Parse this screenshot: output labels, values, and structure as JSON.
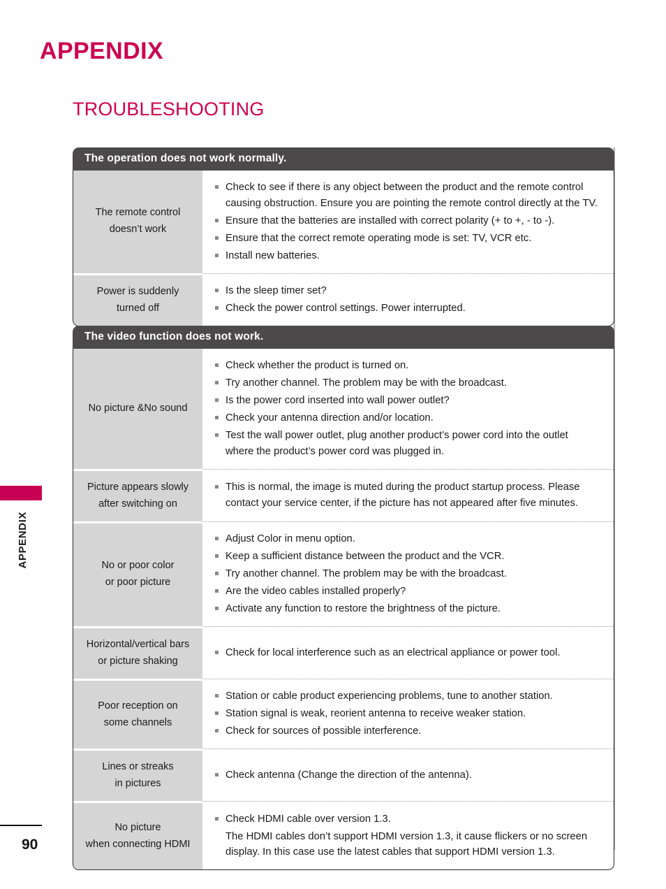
{
  "page": {
    "title": "APPENDIX",
    "section_title": "TROUBLESHOOTING",
    "side_label": "APPENDIX",
    "page_number": "90",
    "accent_color": "#cc0050",
    "header_bar_color": "#4b4949",
    "symptom_cell_color": "#d5d5d5"
  },
  "tables": [
    {
      "header": "The operation does not work normally.",
      "rows": [
        {
          "symptom": "The remote control\ndoesn’t work",
          "symptom_lines": [
            "The remote control",
            "doesn’t work"
          ],
          "fixes": [
            {
              "text": "Check to see if there is any object between the product and the remote control causing obstruction. Ensure you are pointing the remote control directly at the TV.",
              "lines": [
                "Check to see if there is any object between the product and the remote control",
                "causing obstruction. Ensure you are pointing the remote control directly at the TV."
              ]
            },
            {
              "text": "Ensure that the batteries are installed with correct polarity (+ to +, - to -).",
              "lines": [
                "Ensure that the batteries are installed with correct polarity (+ to +, - to -)."
              ]
            },
            {
              "text": "Ensure that the correct remote operating mode is set: TV, VCR etc.",
              "lines": [
                "Ensure that the correct remote operating mode is set: TV, VCR etc."
              ]
            },
            {
              "text": "Install new batteries.",
              "lines": [
                "Install new batteries."
              ]
            }
          ]
        },
        {
          "symptom": "Power is suddenly\nturned off",
          "symptom_lines": [
            "Power is suddenly",
            "turned off"
          ],
          "fixes": [
            {
              "text": "Is the sleep timer set?",
              "lines": [
                "Is the sleep timer set?"
              ]
            },
            {
              "text": "Check the power control settings. Power interrupted.",
              "lines": [
                "Check the power control settings. Power interrupted."
              ]
            }
          ]
        }
      ]
    },
    {
      "header": "The video function does not work.",
      "rows": [
        {
          "symptom": "No picture &No sound",
          "symptom_lines": [
            "No picture &No sound"
          ],
          "fixes": [
            {
              "text": "Check whether the product is turned on.",
              "lines": [
                "Check whether the product is turned on."
              ]
            },
            {
              "text": "Try another channel. The problem may be with the broadcast.",
              "lines": [
                "Try another channel. The problem may be with the broadcast."
              ]
            },
            {
              "text": "Is the power cord inserted into wall power outlet?",
              "lines": [
                "Is the power cord inserted into wall power outlet?"
              ]
            },
            {
              "text": "Check your antenna direction and/or location.",
              "lines": [
                "Check your antenna direction and/or location."
              ]
            },
            {
              "text": "Test the wall power outlet, plug another product’s power cord into the outlet where the product’s power cord was plugged in.",
              "lines": [
                "Test the wall power outlet, plug another product’s power cord into the outlet",
                "where the product’s power cord was plugged in."
              ]
            }
          ]
        },
        {
          "symptom": "Picture appears slowly\nafter switching on",
          "symptom_lines": [
            "Picture appears slowly",
            "after switching on"
          ],
          "fixes": [
            {
              "text": "This is normal, the image is muted during the product startup process. Please contact your service center, if the picture has not appeared after five minutes.",
              "lines": [
                "This is normal, the image is muted during the product startup process. Please",
                "contact your service center, if the picture has not appeared after five minutes."
              ]
            }
          ]
        },
        {
          "symptom": "No or poor color\nor poor picture",
          "symptom_lines": [
            "No or poor color",
            "or poor picture"
          ],
          "fixes": [
            {
              "text": "Adjust Color in menu option.",
              "lines": [
                "Adjust Color in menu option."
              ]
            },
            {
              "text": "Keep a sufficient distance between the product and the VCR.",
              "lines": [
                "Keep a sufficient distance between the product and the VCR."
              ]
            },
            {
              "text": "Try another channel. The problem may be with the broadcast.",
              "lines": [
                "Try another channel. The problem may be with the broadcast."
              ]
            },
            {
              "text": "Are the video cables installed properly?",
              "lines": [
                "Are the video cables installed properly?"
              ]
            },
            {
              "text": "Activate any function to restore the brightness of the picture.",
              "lines": [
                "Activate any function to restore the brightness of the picture."
              ]
            }
          ]
        },
        {
          "symptom": "Horizontal/vertical bars\nor picture shaking",
          "symptom_lines": [
            "Horizontal/vertical bars",
            "or picture shaking"
          ],
          "fixes": [
            {
              "text": "Check for local interference such as an electrical appliance or power tool.",
              "lines": [
                "Check for local interference such as an electrical appliance or power tool."
              ]
            }
          ]
        },
        {
          "symptom": "Poor reception on\nsome channels",
          "symptom_lines": [
            "Poor reception on",
            "some channels"
          ],
          "fixes": [
            {
              "text": "Station or cable product experiencing problems, tune to another station.",
              "lines": [
                "Station or cable product experiencing problems, tune to another station."
              ]
            },
            {
              "text": "Station signal is weak, reorient antenna to receive weaker station.",
              "lines": [
                "Station signal is weak, reorient antenna to receive weaker station."
              ]
            },
            {
              "text": "Check for sources of possible interference.",
              "lines": [
                "Check for sources of possible interference."
              ]
            }
          ]
        },
        {
          "symptom": "Lines or streaks\nin pictures",
          "symptom_lines": [
            "Lines or streaks",
            "in pictures"
          ],
          "fixes": [
            {
              "text": "Check antenna (Change the direction of the antenna).",
              "lines": [
                "Check antenna (Change the direction of the antenna)."
              ]
            }
          ]
        },
        {
          "symptom": "No picture\nwhen connecting HDMI",
          "symptom_lines": [
            "No picture",
            "when connecting HDMI"
          ],
          "fixes": [
            {
              "text": "Check HDMI cable over version 1.3.",
              "lines": [
                "Check HDMI cable over version 1.3."
              ]
            },
            {
              "bullet": false,
              "text": "The HDMI cables don’t support HDMI version 1.3, it cause flickers or no screen display. In this case use the latest cables that support HDMI version 1.3.",
              "lines": [
                "The HDMI cables don’t support HDMI version 1.3, it cause flickers or no screen",
                "display. In this case use the latest cables that support HDMI version 1.3."
              ]
            }
          ]
        }
      ]
    }
  ]
}
